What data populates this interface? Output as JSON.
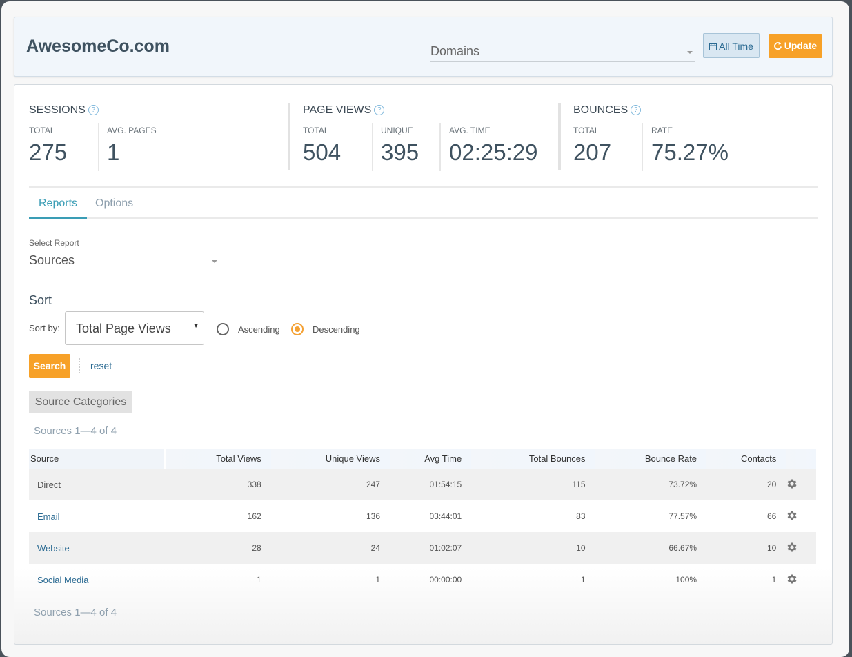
{
  "header": {
    "site_title": "AwesomeCo.com",
    "domain_select": "Domains",
    "all_time_label": "All Time",
    "update_label": "Update"
  },
  "stats": {
    "sessions": {
      "label": "SESSIONS",
      "total_label": "TOTAL",
      "total": "275",
      "avg_pages_label": "AVG. PAGES",
      "avg_pages": "1"
    },
    "page_views": {
      "label": "PAGE VIEWS",
      "total_label": "TOTAL",
      "total": "504",
      "unique_label": "UNIQUE",
      "unique": "395",
      "avg_time_label": "AVG. TIME",
      "avg_time": "02:25:29"
    },
    "bounces": {
      "label": "BOUNCES",
      "total_label": "TOTAL",
      "total": "207",
      "rate_label": "RATE",
      "rate": "75.27%"
    }
  },
  "tabs": [
    {
      "label": "Reports",
      "active": true
    },
    {
      "label": "Options",
      "active": false
    }
  ],
  "report": {
    "select_label": "Select Report",
    "selected": "Sources"
  },
  "sort": {
    "heading": "Sort",
    "sort_by_label": "Sort by:",
    "selected": "Total Page Views",
    "ascending_label": "Ascending",
    "descending_label": "Descending",
    "order": "descending"
  },
  "actions": {
    "search_label": "Search",
    "reset_label": "reset",
    "categories_label": "Source Categories"
  },
  "pager_text": "Sources 1—4 of 4",
  "table": {
    "headers": [
      "Source",
      "Total Views",
      "Unique Views",
      "Avg Time",
      "Total Bounces",
      "Bounce Rate",
      "Contacts"
    ],
    "rows": [
      {
        "source": "Direct",
        "total_views": "338",
        "unique_views": "247",
        "avg_time": "01:54:15",
        "total_bounces": "115",
        "bounce_rate": "73.72%",
        "contacts": "20"
      },
      {
        "source": "Email",
        "total_views": "162",
        "unique_views": "136",
        "avg_time": "03:44:01",
        "total_bounces": "83",
        "bounce_rate": "77.57%",
        "contacts": "66"
      },
      {
        "source": "Website",
        "total_views": "28",
        "unique_views": "24",
        "avg_time": "01:02:07",
        "total_bounces": "10",
        "bounce_rate": "66.67%",
        "contacts": "10"
      },
      {
        "source": "Social Media",
        "total_views": "1",
        "unique_views": "1",
        "avg_time": "00:00:00",
        "total_bounces": "1",
        "bounce_rate": "100%",
        "contacts": "1"
      }
    ]
  },
  "colors": {
    "accent_orange": "#f7a128",
    "accent_teal": "#3a9db5",
    "link_blue": "#2a6a92"
  },
  "icons": {
    "calendar": "calendar-icon",
    "refresh": "refresh-icon",
    "help": "help-icon",
    "gear": "gear-icon"
  }
}
